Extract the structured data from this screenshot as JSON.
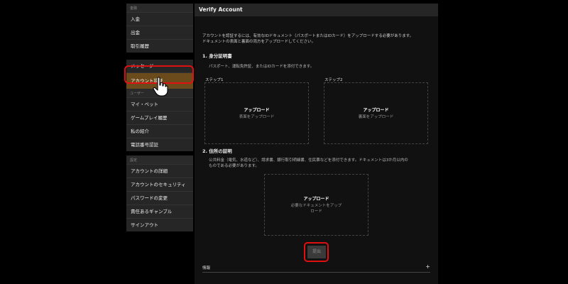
{
  "sidebar": {
    "groups": [
      {
        "label": "金融",
        "items": [
          {
            "label": "入金"
          },
          {
            "label": "出金"
          },
          {
            "label": "取引履歴"
          }
        ]
      },
      {
        "label": "",
        "items": [
          {
            "label": "メッセージ"
          },
          {
            "label": "アカウント認証"
          }
        ]
      },
      {
        "label": "ユーザー",
        "items": [
          {
            "label": "マイ・ベット"
          },
          {
            "label": "ゲームプレイ履歴"
          },
          {
            "label": "私の紹介"
          },
          {
            "label": "電話番号認証"
          }
        ]
      },
      {
        "label": "設定",
        "items": [
          {
            "label": "アカウントの詳細"
          },
          {
            "label": "アカウントのセキュリティ"
          },
          {
            "label": "パスワードの変更"
          },
          {
            "label": "責任あるギャンブル"
          },
          {
            "label": "サインアウト"
          }
        ]
      }
    ],
    "active_item": "アカウント認証"
  },
  "main": {
    "title": "Verify Account",
    "intro_line1": "アカウントを認証するには、有効なIDドキュメント（パスポートまたはIDカード）をアップロードする必要があります。",
    "intro_line2": "ドキュメントの表面と裏面の両方をアップロードしてください。",
    "section1": {
      "title": "1. 身分証明書",
      "desc": "パスポート、運転免許証、またはIDカードを添付できます。",
      "steps": [
        {
          "label": "ステップ1",
          "upload_title": "アップロード",
          "upload_sub": "表面をアップロード"
        },
        {
          "label": "ステップ2",
          "upload_title": "アップロード",
          "upload_sub": "裏面をアップロード"
        }
      ]
    },
    "section2": {
      "title": "2. 住所の証明",
      "desc_line1": "公共料金（電気、水道など）、請求書、銀行取引明細書、住民票などを添付できます。ドキュメントは3か月以内の",
      "desc_line2": "ものである必要があります。",
      "upload_title": "アップロード",
      "upload_sub_line1": "必要なドキュメントをアップ",
      "upload_sub_line2": "ロード"
    },
    "submit_label": "提出",
    "info_label": "情報",
    "info_toggle": "+"
  },
  "colors": {
    "active_bg": "#6b4a1c",
    "highlight": "#e01010",
    "panel_bg": "#111111",
    "sidebar_bg": "#262626"
  },
  "icons": {
    "cursor": "hand-pointer-icon",
    "expand": "plus-icon"
  }
}
